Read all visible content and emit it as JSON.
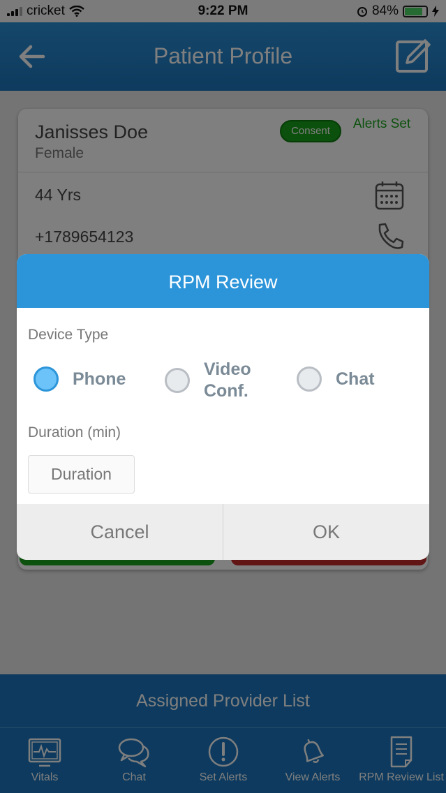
{
  "status_bar": {
    "carrier": "cricket",
    "time": "9:22 PM",
    "battery": "84%",
    "battery_level": 0.84
  },
  "header": {
    "title": "Patient Profile"
  },
  "patient": {
    "name": "Janisses Doe",
    "gender": "Female",
    "consent_badge": "Consent",
    "alerts_set": "Alerts Set",
    "age": "44 Yrs",
    "phone": "+1789654123"
  },
  "dialog": {
    "title": "RPM Review",
    "device_type_label": "Device Type",
    "options": [
      {
        "label": "Phone",
        "selected": true
      },
      {
        "label": "Video Conf.",
        "selected": false
      },
      {
        "label": "Chat",
        "selected": false
      }
    ],
    "duration_label": "Duration (min)",
    "duration_placeholder": "Duration",
    "cancel_label": "Cancel",
    "ok_label": "OK"
  },
  "assigned_provider": "Assigned Provider List",
  "tabs": [
    {
      "label": "Vitals",
      "icon": "vitals-monitor-icon"
    },
    {
      "label": "Chat",
      "icon": "chat-bubbles-icon"
    },
    {
      "label": "Set Alerts",
      "icon": "exclamation-circle-icon"
    },
    {
      "label": "View Alerts",
      "icon": "bell-icon"
    },
    {
      "label": "RPM Review List",
      "icon": "document-list-icon"
    }
  ],
  "colors": {
    "primary": "#1b75bc",
    "dialog_header": "#2c95d9",
    "green": "#1aa31c",
    "red": "#c42b2b",
    "selected_radio": "#6cc3f9"
  }
}
